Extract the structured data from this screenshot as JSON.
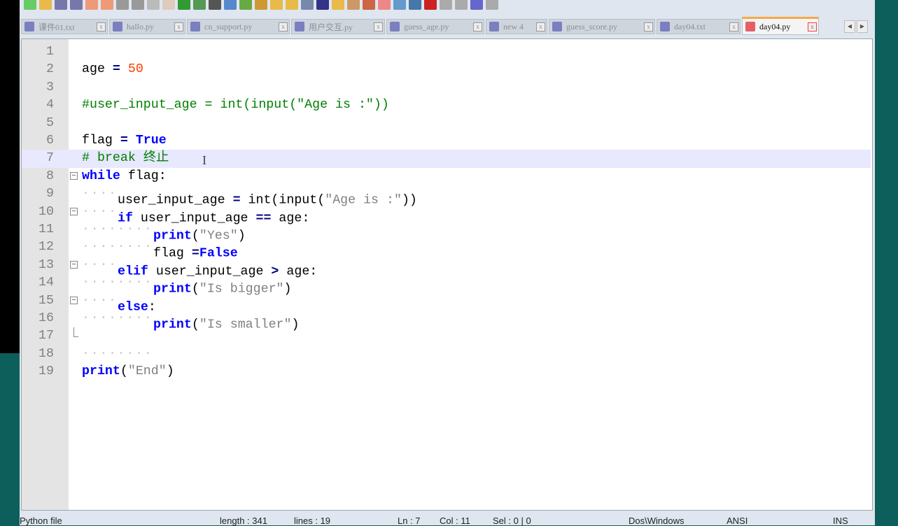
{
  "toolbar": {
    "icons": [
      "new-file",
      "open-file",
      "save",
      "save-all",
      "close",
      "close-all",
      "print",
      "cut",
      "copy",
      "paste",
      "undo",
      "redo",
      "find",
      "replace",
      "zoom-in",
      "zoom-out",
      "sync-v",
      "sync-h",
      "word-wrap",
      "show-all",
      "indent-guide",
      "user-lang",
      "doc-map",
      "function-list",
      "folder-workspace",
      "monitor",
      "record-macro",
      "stop-macro",
      "play-macro",
      "run-macro-multiple",
      "save-macro"
    ]
  },
  "tabs": [
    {
      "label": "课件01.txt",
      "active": false
    },
    {
      "label": "hallo.py",
      "active": false
    },
    {
      "label": "cn_support.py",
      "active": false
    },
    {
      "label": "用户交互.py",
      "active": false
    },
    {
      "label": "guess_age.py",
      "active": false
    },
    {
      "label": "new 4",
      "active": false
    },
    {
      "label": "guess_score.py",
      "active": false
    },
    {
      "label": "day04.txt",
      "active": false
    },
    {
      "label": "day04.py",
      "active": true
    }
  ],
  "editor": {
    "current_line": 7,
    "lines": [
      {
        "n": "1",
        "indent": 0,
        "tokens": []
      },
      {
        "n": "2",
        "indent": 0,
        "tokens": [
          [
            "id",
            "age "
          ],
          [
            "op",
            "="
          ],
          [
            "id",
            " "
          ],
          [
            "num",
            "50"
          ]
        ]
      },
      {
        "n": "3",
        "indent": 0,
        "tokens": []
      },
      {
        "n": "4",
        "indent": 0,
        "tokens": [
          [
            "com",
            "#user_input_age = int(input(\"Age is :\"))"
          ]
        ]
      },
      {
        "n": "5",
        "indent": 0,
        "tokens": []
      },
      {
        "n": "6",
        "indent": 0,
        "tokens": [
          [
            "id",
            "flag "
          ],
          [
            "op",
            "="
          ],
          [
            "id",
            " "
          ],
          [
            "kw",
            "True"
          ]
        ]
      },
      {
        "n": "7",
        "indent": 0,
        "tokens": [
          [
            "com",
            "# break 终止"
          ]
        ]
      },
      {
        "n": "8",
        "indent": 0,
        "fold": "open",
        "tokens": [
          [
            "kw",
            "while"
          ],
          [
            "id",
            " flag:"
          ]
        ]
      },
      {
        "n": "9",
        "indent": 1,
        "tokens": [
          [
            "id",
            "user_input_age "
          ],
          [
            "op",
            "="
          ],
          [
            "id",
            " int(input("
          ],
          [
            "str",
            "\"Age is :\""
          ],
          [
            "id",
            "))"
          ]
        ]
      },
      {
        "n": "10",
        "indent": 1,
        "fold": "open",
        "tokens": [
          [
            "kw",
            "if"
          ],
          [
            "id",
            " user_input_age "
          ],
          [
            "op",
            "=="
          ],
          [
            "id",
            " age:"
          ]
        ]
      },
      {
        "n": "11",
        "indent": 2,
        "tokens": [
          [
            "kw",
            "print"
          ],
          [
            "id",
            "("
          ],
          [
            "str",
            "\"Yes\""
          ],
          [
            "id",
            ")"
          ]
        ]
      },
      {
        "n": "12",
        "indent": 2,
        "tokens": [
          [
            "id",
            "flag "
          ],
          [
            "op",
            "="
          ],
          [
            "kw",
            "False"
          ]
        ]
      },
      {
        "n": "13",
        "indent": 1,
        "fold": "open",
        "tokens": [
          [
            "kw",
            "elif"
          ],
          [
            "id",
            " user_input_age "
          ],
          [
            "op",
            ">"
          ],
          [
            "id",
            " age:"
          ]
        ]
      },
      {
        "n": "14",
        "indent": 2,
        "tokens": [
          [
            "kw",
            "print"
          ],
          [
            "id",
            "("
          ],
          [
            "str",
            "\"Is bigger\""
          ],
          [
            "id",
            ")"
          ]
        ]
      },
      {
        "n": "15",
        "indent": 1,
        "fold": "open",
        "tokens": [
          [
            "kw",
            "else"
          ],
          [
            "id",
            ":"
          ]
        ]
      },
      {
        "n": "16",
        "indent": 2,
        "tokens": [
          [
            "kw",
            "print"
          ],
          [
            "id",
            "("
          ],
          [
            "str",
            "\"Is smaller\""
          ],
          [
            "id",
            ")"
          ]
        ]
      },
      {
        "n": "17",
        "indent": 0,
        "fold": "end",
        "tokens": []
      },
      {
        "n": "18",
        "indent": 2,
        "tokens": []
      },
      {
        "n": "19",
        "indent": 0,
        "tokens": [
          [
            "kw",
            "print"
          ],
          [
            "id",
            "("
          ],
          [
            "str",
            "\"End\""
          ],
          [
            "id",
            ")"
          ]
        ]
      }
    ]
  },
  "status": {
    "file_type": "Python file",
    "length": "length : 341",
    "lines": "lines : 19",
    "ln": "Ln : 7",
    "col": "Col : 11",
    "sel": "Sel : 0 | 0",
    "eol": "Dos\\Windows",
    "encoding": "ANSI",
    "mode": "INS"
  },
  "colors": {
    "keyword": "#0000ff",
    "number": "#ff3c00",
    "string": "#808080",
    "comment": "#008000",
    "current_line": "#e8e8ff",
    "active_tab_accent": "#f5a945"
  }
}
